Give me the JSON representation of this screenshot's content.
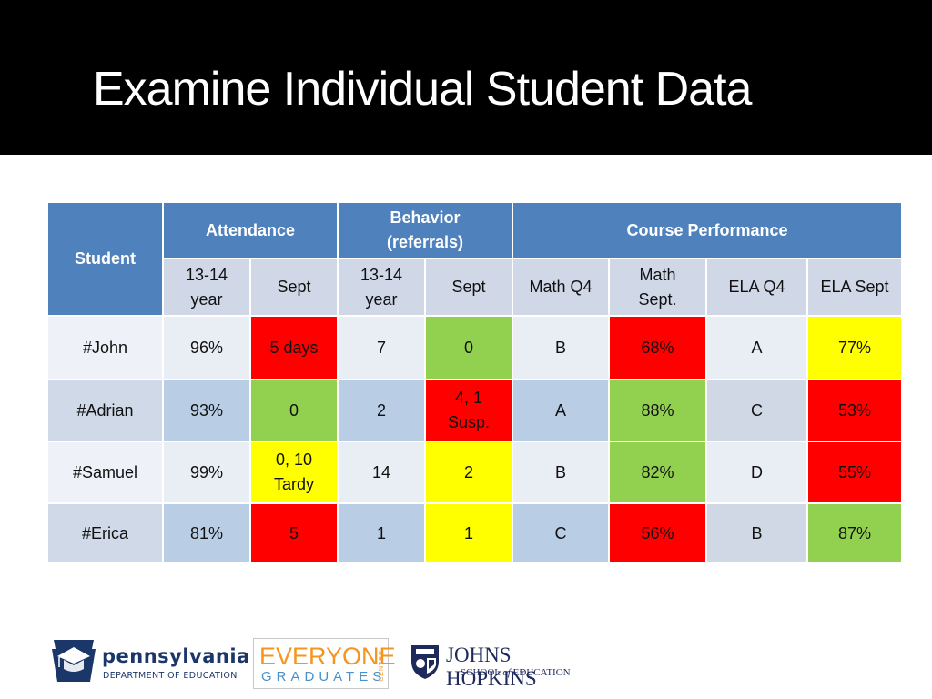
{
  "title": "Examine Individual Student Data",
  "table": {
    "header_groups": {
      "student": "Student",
      "attendance": "Attendance",
      "behavior_line1": "Behavior",
      "behavior_line2": "(referrals)",
      "course": "Course Performance"
    },
    "subheaders": [
      {
        "line1": "13-14",
        "line2": "year"
      },
      {
        "line1": "Sept",
        "line2": ""
      },
      {
        "line1": "13-14",
        "line2": "year"
      },
      {
        "line1": "Sept",
        "line2": ""
      },
      {
        "line1": "Math Q4",
        "line2": ""
      },
      {
        "line1": "Math",
        "line2": "Sept."
      },
      {
        "line1": "ELA Q4",
        "line2": ""
      },
      {
        "line1": "ELA Sept",
        "line2": ""
      }
    ],
    "rows": [
      {
        "student": "#John",
        "cells": [
          {
            "line1": "96%",
            "line2": "",
            "status": "neutral"
          },
          {
            "line1": "5 days",
            "line2": "",
            "status": "red"
          },
          {
            "line1": "7",
            "line2": "",
            "status": "neutral"
          },
          {
            "line1": "0",
            "line2": "",
            "status": "green"
          },
          {
            "line1": "B",
            "line2": "",
            "status": "neutral"
          },
          {
            "line1": "68%",
            "line2": "",
            "status": "red"
          },
          {
            "line1": "A",
            "line2": "",
            "status": "neutral"
          },
          {
            "line1": "77%",
            "line2": "",
            "status": "yellow"
          }
        ]
      },
      {
        "student": "#Adrian",
        "cells": [
          {
            "line1": "93%",
            "line2": "",
            "status": "neutral"
          },
          {
            "line1": "0",
            "line2": "",
            "status": "green"
          },
          {
            "line1": "2",
            "line2": "",
            "status": "neutral"
          },
          {
            "line1": "4, 1",
            "line2": "Susp.",
            "status": "red"
          },
          {
            "line1": "A",
            "line2": "",
            "status": "neutral"
          },
          {
            "line1": "88%",
            "line2": "",
            "status": "green"
          },
          {
            "line1": "C",
            "line2": "",
            "status": "neutral"
          },
          {
            "line1": "53%",
            "line2": "",
            "status": "red"
          }
        ]
      },
      {
        "student": "#Samuel",
        "cells": [
          {
            "line1": "99%",
            "line2": "",
            "status": "neutral"
          },
          {
            "line1": "0, 10",
            "line2": "Tardy",
            "status": "yellow"
          },
          {
            "line1": "14",
            "line2": "",
            "status": "neutral"
          },
          {
            "line1": "2",
            "line2": "",
            "status": "yellow"
          },
          {
            "line1": "B",
            "line2": "",
            "status": "neutral"
          },
          {
            "line1": "82%",
            "line2": "",
            "status": "green"
          },
          {
            "line1": "D",
            "line2": "",
            "status": "neutral"
          },
          {
            "line1": "55%",
            "line2": "",
            "status": "red"
          }
        ]
      },
      {
        "student": "#Erica",
        "cells": [
          {
            "line1": "81%",
            "line2": "",
            "status": "neutral"
          },
          {
            "line1": "5",
            "line2": "",
            "status": "red"
          },
          {
            "line1": "1",
            "line2": "",
            "status": "neutral"
          },
          {
            "line1": "1",
            "line2": "",
            "status": "yellow"
          },
          {
            "line1": "C",
            "line2": "",
            "status": "neutral"
          },
          {
            "line1": "56%",
            "line2": "",
            "status": "red"
          },
          {
            "line1": "B",
            "line2": "",
            "status": "neutral"
          },
          {
            "line1": "87%",
            "line2": "",
            "status": "green"
          }
        ]
      }
    ],
    "status_colors": {
      "red": "#ff0000",
      "green": "#92d050",
      "yellow": "#ffff00",
      "header": "#4f81bd"
    }
  },
  "logos": {
    "pennsylvania": {
      "name": "pennsylvania",
      "subtitle": "DEPARTMENT OF EDUCATION"
    },
    "everyone_graduates": {
      "line1": "EVERYONE",
      "line2": "GRADUATES",
      "side": "CENTER"
    },
    "johns_hopkins": {
      "name": "JOHNS HOPKINS",
      "subtitle_pre": "SCHOOL ",
      "subtitle_of": "of",
      "subtitle_post": " EDUCATION"
    }
  }
}
